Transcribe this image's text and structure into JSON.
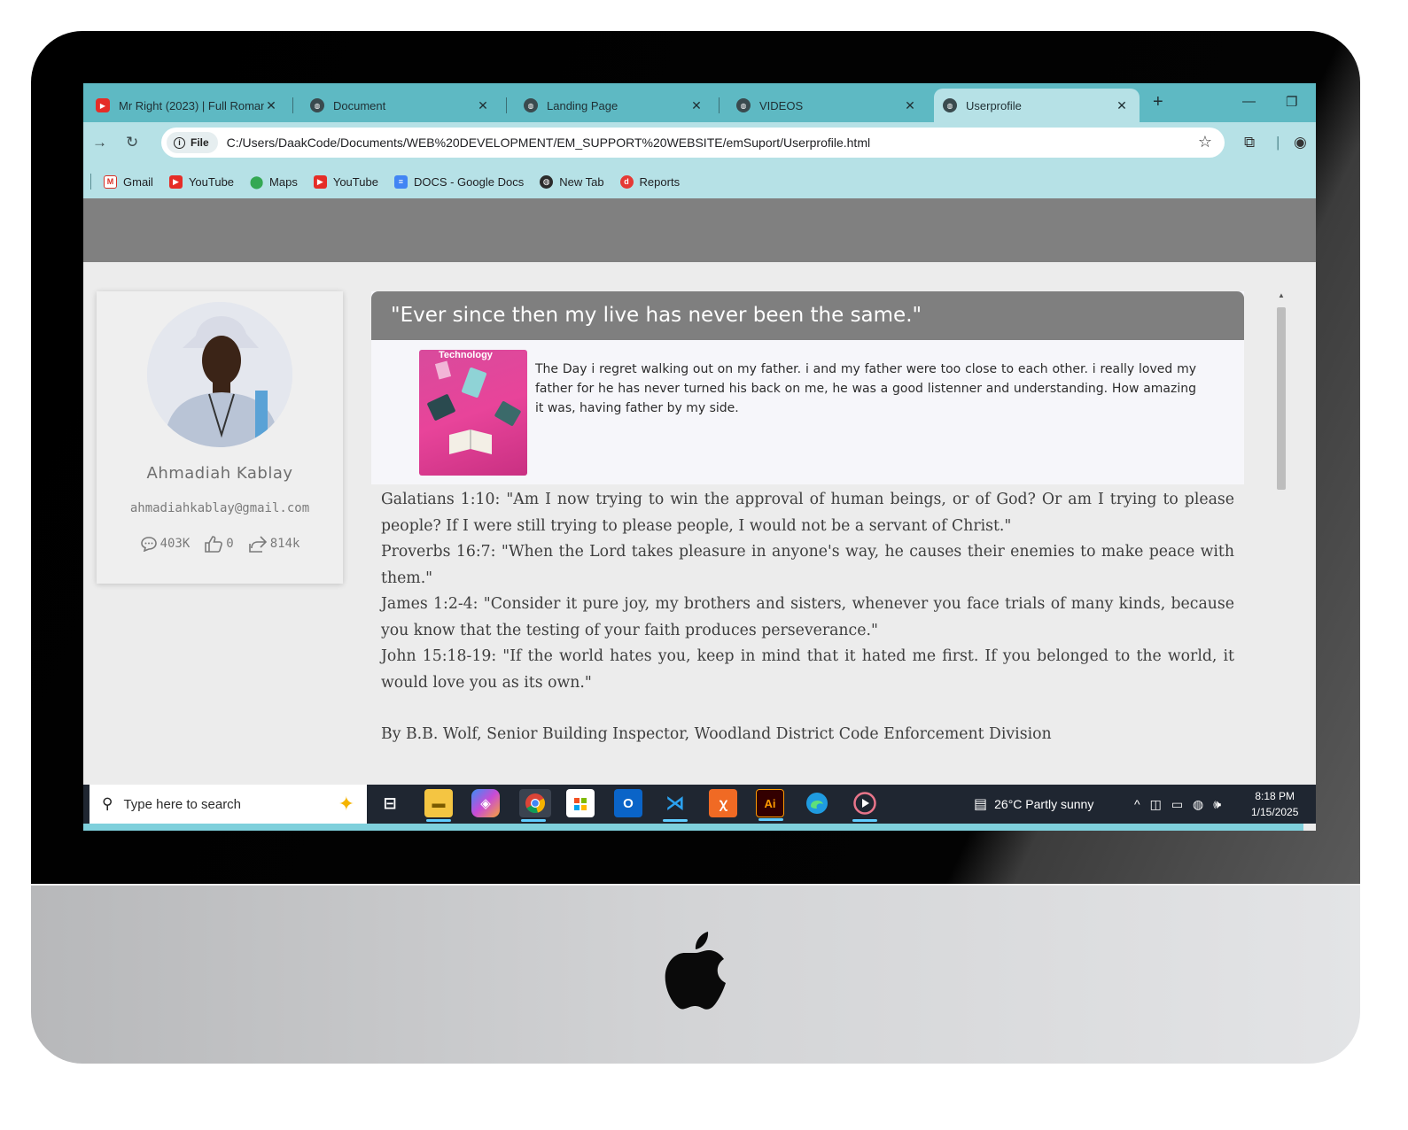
{
  "browser": {
    "tabs": [
      {
        "title": "Mr Right (2023) | Full Roman",
        "icon": "youtube-icon"
      },
      {
        "title": "Document",
        "icon": "globe-icon"
      },
      {
        "title": "Landing Page",
        "icon": "globe-icon"
      },
      {
        "title": "VIDEOS",
        "icon": "globe-icon"
      },
      {
        "title": "Userprofile",
        "icon": "globe-icon",
        "active": true
      }
    ],
    "address": {
      "chip_label": "File",
      "url": "C:/Users/DaakCode/Documents/WEB%20DEVELOPMENT/EM_SUPPORT%20WEBSITE/emSuport/Userprofile.html"
    },
    "bookmarks": [
      {
        "label": "Gmail",
        "icon": "gmail-icon"
      },
      {
        "label": "YouTube",
        "icon": "youtube-icon"
      },
      {
        "label": "Maps",
        "icon": "maps-icon"
      },
      {
        "label": "YouTube",
        "icon": "youtube-icon"
      },
      {
        "label": "DOCS - Google Docs",
        "icon": "docs-icon"
      },
      {
        "label": "New Tab",
        "icon": "globe-icon"
      },
      {
        "label": "Reports",
        "icon": "reports-icon"
      }
    ],
    "colors": {
      "tabstrip": "#5eb9c3",
      "toolbar": "#b6e1e6"
    }
  },
  "profile": {
    "name": "Ahmadiah Kablay",
    "email": "ahmadiahkablay@gmail.com",
    "comments": "403K",
    "likes": "0",
    "shares": "814k"
  },
  "story": {
    "title": "\"Ever since then my live has never been the same.\"",
    "image_label": "Technology",
    "body": "The Day i regret walking out on my father. i and my father were too close to each other. i really loved my father for he has never turned his back on me, he was a good listenner and understanding. How amazing it was, having father by my side."
  },
  "verses": [
    "Galatians 1:10: \"Am I now trying to win the approval of human beings, or of God? Or am I trying to please people? If I were still trying to please people, I would not be a servant of Christ.\"",
    "Proverbs 16:7: \"When the Lord takes pleasure in anyone's way, he causes their enemies to make peace with them.\"",
    "James 1:2-4: \"Consider it pure joy, my brothers and sisters, whenever you face trials of many kinds, because you know that the testing of your faith produces perseverance.\"",
    "John 15:18-19: \"If the world hates you, keep in mind that it hated me first. If you belonged to the world, it would love you as its own.\""
  ],
  "byline": "By B.B. Wolf, Senior Building Inspector, Woodland District Code Enforcement Division",
  "taskbar": {
    "search_placeholder": "Type here to search",
    "weather": "26°C  Partly sunny",
    "time": "8:18 PM",
    "date": "1/15/2025",
    "apps": [
      "task-view",
      "file-explorer",
      "copilot",
      "chrome",
      "microsoft-store",
      "outlook",
      "vscode",
      "xampp",
      "illustrator",
      "edge",
      "media-player"
    ]
  }
}
